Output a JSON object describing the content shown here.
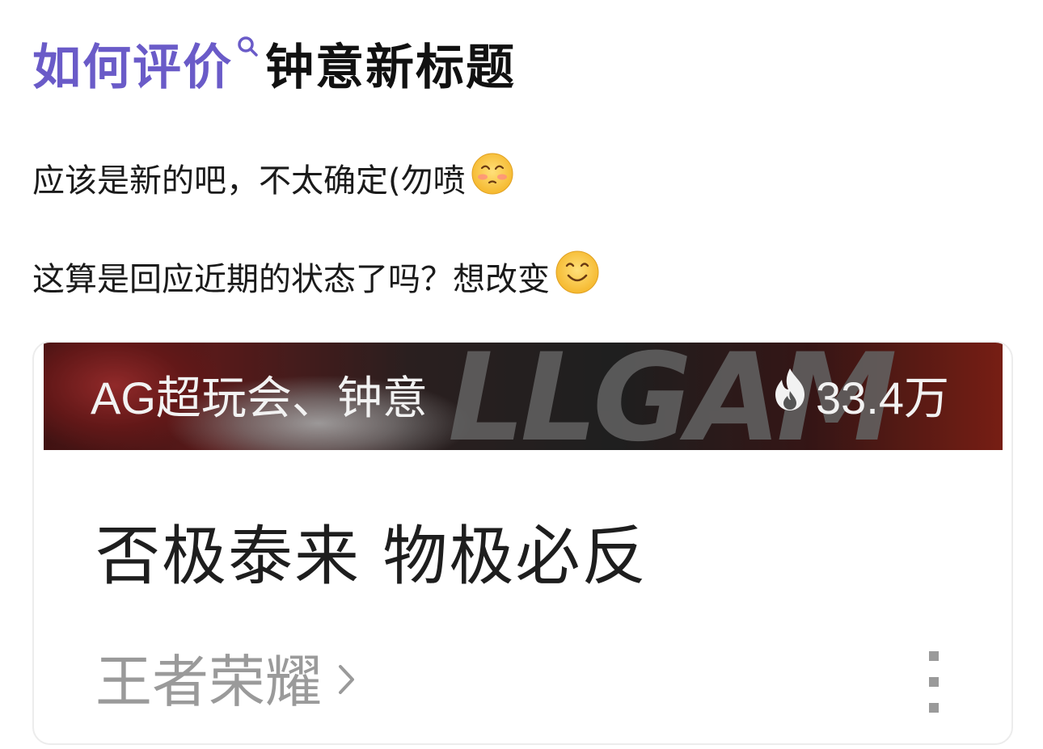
{
  "title": {
    "link_text": "如何评价",
    "rest_text": "钟意新标题",
    "link_color": "#6a5bc8",
    "search_icon": "search-icon"
  },
  "lines": [
    {
      "text": "应该是新的吧，不太确定(勿喷",
      "emoji": "blushing-face-emoji"
    },
    {
      "text": "这算是回应近期的状态了吗？想改变",
      "emoji": "smiling-face-emoji"
    }
  ],
  "card": {
    "banner_title": "AG超玩会、钟意",
    "hot_icon": "flame-icon",
    "hot_count": "33.4万",
    "banner_watermark": "LLGAM",
    "post_title": "否极泰来 物极必反",
    "category": "王者荣耀",
    "category_icon": "chevron-right-icon",
    "more_icon": "more-vertical-icon"
  }
}
